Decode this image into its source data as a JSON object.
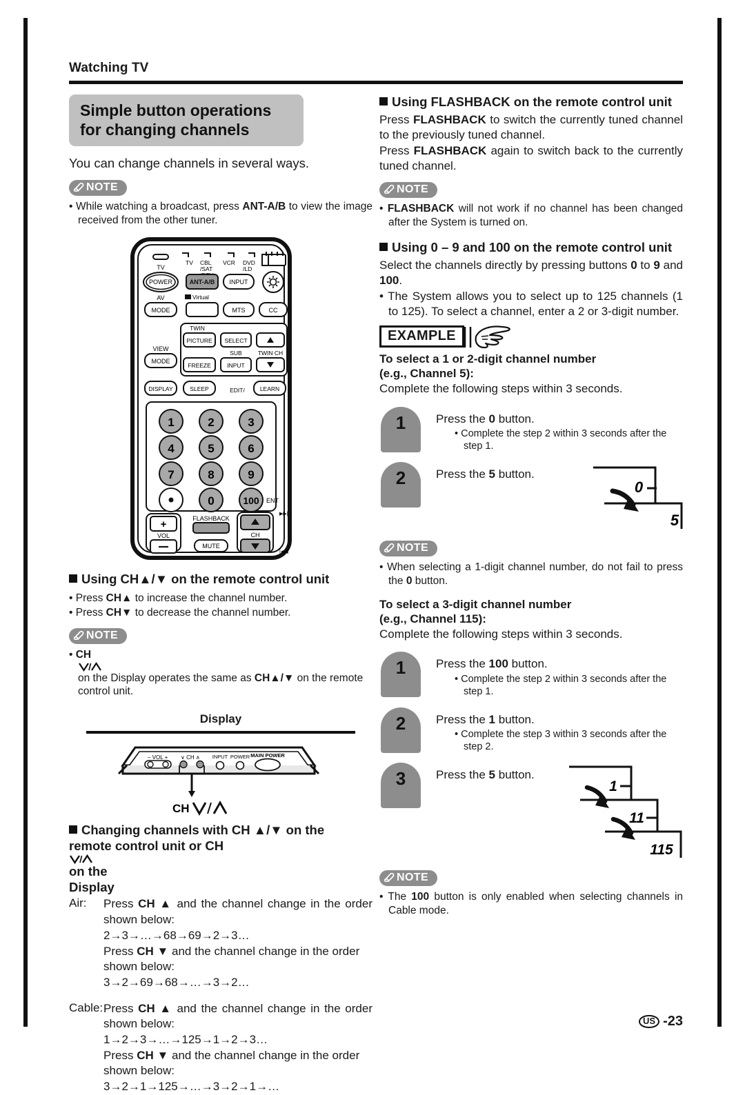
{
  "running_head": "Watching TV",
  "section": {
    "title": "Simple button operations for changing channels",
    "lead": "You can change channels in several ways."
  },
  "note_label": "NOTE",
  "notes": {
    "ant": "While watching a broadcast, press ANT-A/B to view the image received from the other tuner.",
    "ant_pre": "While watching a broadcast, press ",
    "ant_bold": "ANT-A/B",
    "ant_post": " to view the image received from the other tuner.",
    "chdisplay_pre": "",
    "chdisplay_b1": "CH",
    "chdisplay_mid": " on the Display operates the same as ",
    "chdisplay_b2": "CH",
    "chdisplay_post": " on the remote control unit.",
    "flashback_bold": "FLASHBACK",
    "flashback_rest": " will not work if no channel has been changed after the System is turned on.",
    "onedigit_pre": "When selecting a 1-digit channel number, do not fail to press the ",
    "onedigit_bold": "0",
    "onedigit_post": " button.",
    "hundred_pre": "The ",
    "hundred_bold": "100",
    "hundred_post": " button is only enabled when selecting channels in Cable mode."
  },
  "remote": {
    "device_labels": [
      "TV",
      "CBL /SAT /DTV",
      "VCR",
      "DVD /LD"
    ],
    "tv_led": "TV",
    "power": "POWER",
    "ant_ab": "ANT-A/B",
    "input": "INPUT",
    "light_icon": "sun-icon",
    "av": "AV",
    "mode1": "MODE",
    "virtual": "Virtual",
    "mts": "MTS",
    "cc": "CC",
    "twin": "TWIN",
    "picture": "PICTURE",
    "select": "SELECT",
    "view": "VIEW",
    "mode2": "MODE",
    "freeze": "FREEZE",
    "sub": "SUB",
    "sub_input": "INPUT",
    "twin_ch": "TWIN CH",
    "display": "DISPLAY",
    "sleep": "SLEEP",
    "edit": "EDIT/",
    "learn": "LEARN",
    "keys": [
      "1",
      "2",
      "3",
      "4",
      "5",
      "6",
      "7",
      "8",
      "9",
      "•",
      "0",
      "100"
    ],
    "ent": "ENT",
    "plus": "+",
    "minus": "–",
    "vol": "VOL",
    "flashback": "FLASHBACK",
    "mute": "MUTE",
    "ch": "CH"
  },
  "sections": {
    "using_ch": {
      "heading": "Using CH▲/▼ on the remote control unit",
      "bullet1_pre": "Press ",
      "bullet1_bold": "CH▲",
      "bullet1_post": " to increase the channel number.",
      "bullet2_pre": "Press ",
      "bullet2_bold": "CH▼",
      "bullet2_post": " to decrease the channel number."
    },
    "display_panel": {
      "label": "Display",
      "vol": "VOL",
      "vol_minus": "–",
      "vol_plus": "+",
      "ch": "CH",
      "input": "INPUT",
      "power": "POWER",
      "main_power": "MAIN POWER",
      "caption": "CH"
    },
    "changing": {
      "heading_line1": "Changing channels with CH ▲/▼ on the",
      "heading_line2": "remote control unit or CH        on the",
      "heading_line3": "Display",
      "air_label": "Air:",
      "air_up_pre": "Press ",
      "air_up_bold": "CH ▲",
      "air_up_post": " and the channel change in the order shown below:",
      "air_up_seq": "2→3→…→68→69→2→3…",
      "air_dn_pre": "Press ",
      "air_dn_bold": "CH ▼",
      "air_dn_post": " and the channel change in the order shown below:",
      "air_dn_seq": "3→2→69→68→…→3→2…",
      "cable_label": "Cable:",
      "cable_up_pre": "Press ",
      "cable_up_bold": "CH ▲",
      "cable_up_post": " and the channel change in the order shown below:",
      "cable_up_seq": "1→2→3→…→125→1→2→3…",
      "cable_dn_pre": "Press ",
      "cable_dn_bold": "CH ▼",
      "cable_dn_post": " and the channel change in the order shown below:",
      "cable_dn_seq": "3→2→1→125→…→3→2→1→…"
    },
    "flashback": {
      "heading": "Using FLASHBACK on the remote control unit",
      "p1_pre": "Press ",
      "p1_bold": "FLASHBACK",
      "p1_post": " to switch the currently tuned channel to the previously tuned channel.",
      "p2_pre": "Press ",
      "p2_bold": "FLASHBACK",
      "p2_post": " again to switch back to the currently tuned channel."
    },
    "numeric": {
      "heading": "Using 0 – 9 and 100 on the remote control unit",
      "p1_pre": "Select the channels directly by pressing buttons ",
      "p1_b1": "0",
      "p1_mid": " to ",
      "p1_b2": "9",
      "p1_mid2": " and ",
      "p1_b3": "100",
      "p1_post": ".",
      "bullet": "The System allows you to select up to 125 channels (1 to 125). To select a channel, enter a 2 or 3-digit number.",
      "example_label": "EXAMPLE",
      "ex1_title_l1": "To select a 1 or 2-digit channel number",
      "ex1_title_l2": "(e.g., Channel 5):",
      "ex1_intro": "Complete the following steps within 3 seconds.",
      "ex2_title_l1": "To select a 3-digit channel number",
      "ex2_title_l2": "(e.g., Channel 115):",
      "ex2_intro": "Complete the following steps within 3 seconds.",
      "steps_2digit": [
        {
          "num": "1",
          "pre": "Press the ",
          "bold": "0",
          "post": " button.",
          "sub": "Complete the step 2 within 3 seconds after the step 1."
        },
        {
          "num": "2",
          "pre": "Press the ",
          "bold": "5",
          "post": " button.",
          "sub": ""
        }
      ],
      "steps_3digit": [
        {
          "num": "1",
          "pre": "Press the ",
          "bold": "100",
          "post": " button.",
          "sub": "Complete the step 2 within 3 seconds after the step 1."
        },
        {
          "num": "2",
          "pre": "Press the ",
          "bold": "1",
          "post": " button.",
          "sub": "Complete the step 3 within 3 seconds after the step 2."
        },
        {
          "num": "3",
          "pre": "Press the ",
          "bold": "5",
          "post": " button.",
          "sub": ""
        }
      ],
      "stair_2digit": [
        "0",
        "5"
      ],
      "stair_3digit": [
        "1",
        "11",
        "115"
      ]
    }
  },
  "footer": {
    "region": "US",
    "page": "-23"
  },
  "colors": {
    "gray_badge": "#8d8d8d",
    "gray_title": "#c0c0c0",
    "key_gray": "#a8a8a8",
    "ink": "#111111"
  }
}
